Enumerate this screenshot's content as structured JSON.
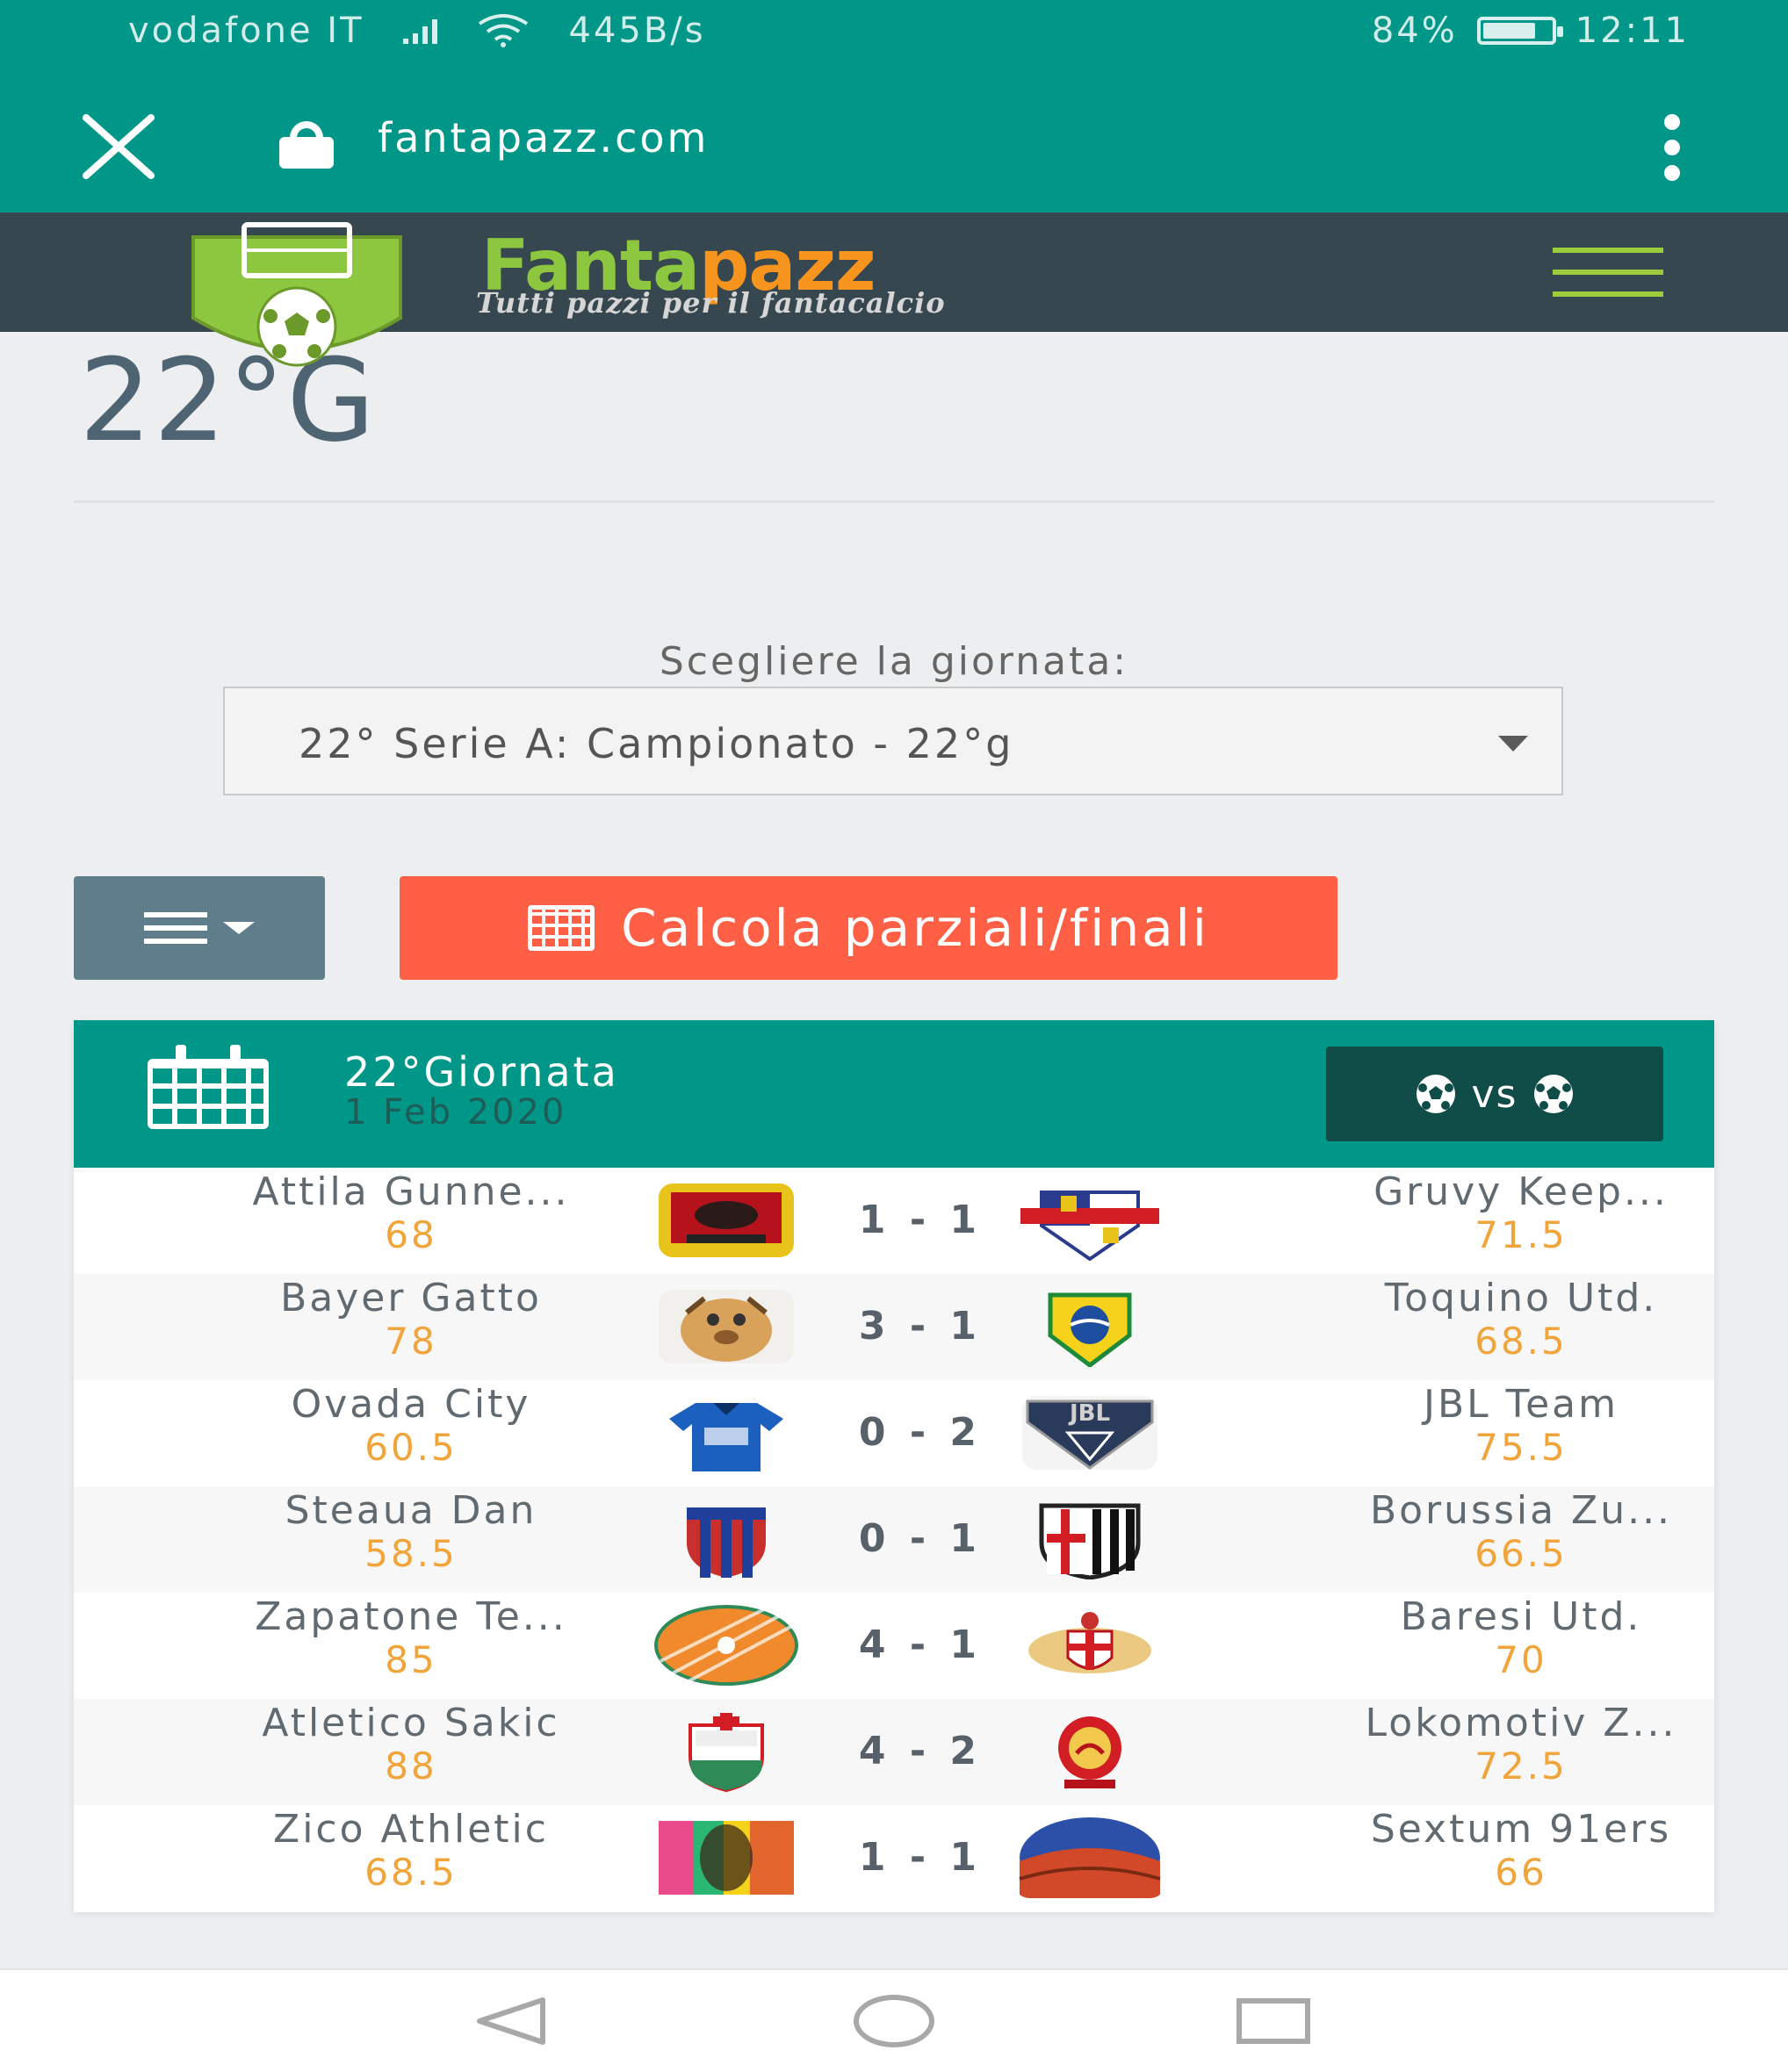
{
  "status_bar": {
    "carrier": "vodafone IT",
    "speed": "445B/s",
    "battery": "84%",
    "battery_level": 0.84,
    "time": "12:11"
  },
  "browser": {
    "url": "fantapazz.com",
    "icons": [
      "close-icon",
      "lock-icon",
      "more-vert-icon"
    ]
  },
  "site": {
    "brand_part1": "Fanta",
    "brand_part2": "pazz",
    "tagline": "Tutti pazzi per il fantacalcio",
    "colors": {
      "brand_green": "#8dc63f",
      "brand_orange": "#f7941d",
      "header": "#37474f",
      "teal": "#009688",
      "cta": "#ff5f44"
    }
  },
  "page": {
    "title": "22°G",
    "select_label": "Scegliere la giornata:",
    "select_value": "22° Serie A: Campionato - 22°g",
    "calc_button": "Calcola parziali/finali"
  },
  "fixtures": {
    "round": "22°Giornata",
    "date": "1 Feb 2020",
    "vs_label": "vs",
    "matches": [
      {
        "home": "Attila Gunne...",
        "home_pts": "68",
        "score": "1 - 1",
        "away": "Gruvy Keep...",
        "away_pts": "71.5"
      },
      {
        "home": "Bayer Gatto",
        "home_pts": "78",
        "score": "3 - 1",
        "away": "Toquino Utd.",
        "away_pts": "68.5"
      },
      {
        "home": "Ovada City",
        "home_pts": "60.5",
        "score": "0 - 2",
        "away": "JBL Team",
        "away_pts": "75.5"
      },
      {
        "home": "Steaua Dan",
        "home_pts": "58.5",
        "score": "0 - 1",
        "away": "Borussia Zu...",
        "away_pts": "66.5"
      },
      {
        "home": "Zapatone Te...",
        "home_pts": "85",
        "score": "4 - 1",
        "away": "Baresi Utd.",
        "away_pts": "70"
      },
      {
        "home": "Atletico Sakic",
        "home_pts": "88",
        "score": "4 - 2",
        "away": "Lokomotiv Z...",
        "away_pts": "72.5"
      },
      {
        "home": "Zico Athletic",
        "home_pts": "68.5",
        "score": "1 - 1",
        "away": "Sextum 91ers",
        "away_pts": "66"
      }
    ]
  }
}
